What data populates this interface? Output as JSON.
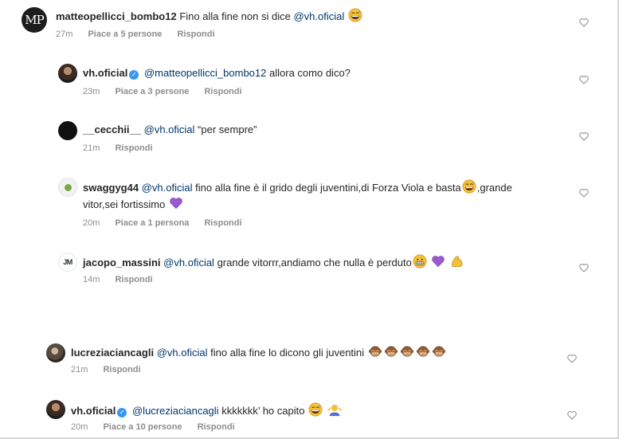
{
  "comments": [
    {
      "avatar_initials": "MP",
      "username": "matteopellicci_bombo12",
      "text": "Fino alla fine non si dice",
      "mention": "@vh.oficial",
      "emoji": [
        "grinning-sweat"
      ],
      "time": "27m",
      "likes": "Piace a 5 persone",
      "reply": "Rispondi"
    },
    {
      "username": "vh.oficial",
      "verified": true,
      "mention": "@matteopellicci_bombo12",
      "text": "allora como dico?",
      "time": "23m",
      "likes": "Piace a 3 persone",
      "reply": "Rispondi"
    },
    {
      "username": "__cecchii__",
      "mention": "@vh.oficial",
      "text": "“per sempre”",
      "time": "21m",
      "reply": "Rispondi"
    },
    {
      "username": "swaggyg44",
      "mention": "@vh.oficial",
      "text": "fino alla fine è il grido degli juventini,di Forza Viola e basta",
      "text_after": ",grande vitor,sei fortissimo",
      "emoji": [
        "grinning-sweat",
        "purple-heart"
      ],
      "time": "20m",
      "likes": "Piace a 1 persona",
      "reply": "Rispondi"
    },
    {
      "avatar_initials": "JM",
      "username": "jacopo_massini",
      "mention": "@vh.oficial",
      "text": "grande vitorrr,andiamo che nulla è perduto",
      "emoji": [
        "grimacing-face",
        "purple-heart",
        "flexed-biceps"
      ],
      "time": "14m",
      "reply": "Rispondi"
    },
    {
      "username": "lucreziaciancagli",
      "mention": "@vh.oficial",
      "text": "fino alla fine lo dicono gli juventini",
      "emoji": [
        "see-no-evil-monkey",
        "see-no-evil-monkey",
        "see-no-evil-monkey",
        "see-no-evil-monkey",
        "see-no-evil-monkey"
      ],
      "time": "21m",
      "reply": "Rispondi"
    },
    {
      "username": "vh.oficial",
      "verified": true,
      "mention": "@lucreziaciancagli",
      "text": "kkkkkkk’ ho capito",
      "emoji": [
        "grinning-sweat",
        "person-shrugging"
      ],
      "time": "20m",
      "likes": "Piace a 10 persone",
      "reply": "Rispondi"
    }
  ],
  "colors": {
    "username": "#262626",
    "mention": "#00376b",
    "meta": "#8e8e8e",
    "verified": "#3897f0",
    "purple_heart": "#9b59d0",
    "emoji_yellow": "#f6c235"
  },
  "icons": {
    "like": "heart-outline-icon",
    "verified": "verified-badge-icon"
  }
}
